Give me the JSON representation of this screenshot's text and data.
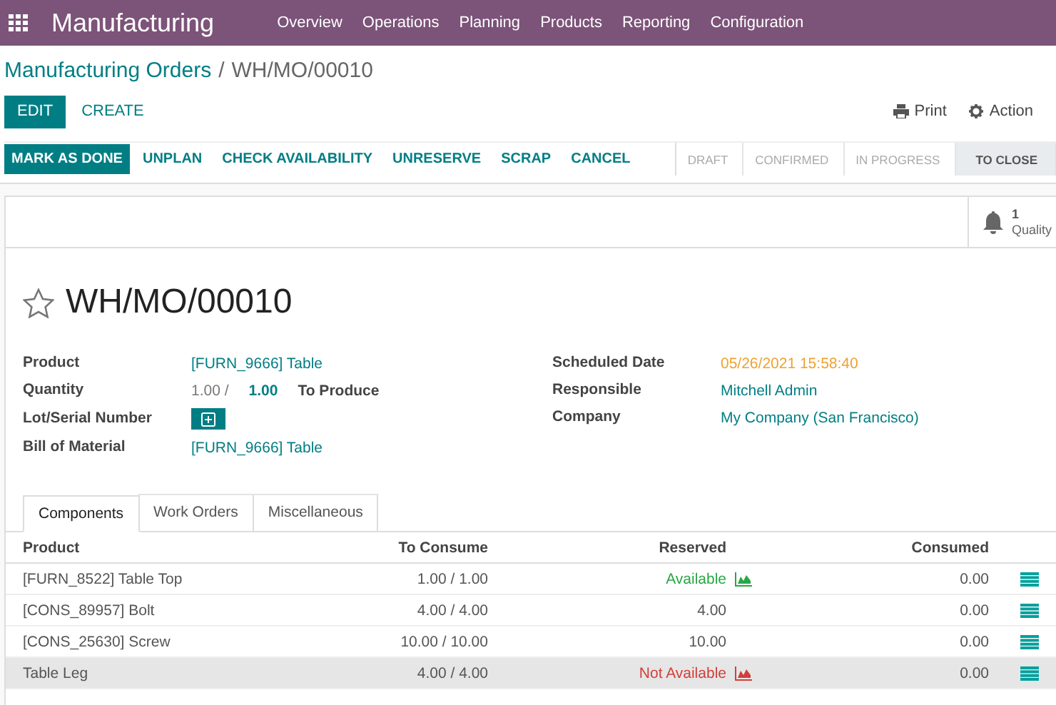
{
  "navbar": {
    "app_name": "Manufacturing",
    "menu": [
      "Overview",
      "Operations",
      "Planning",
      "Products",
      "Reporting",
      "Configuration"
    ]
  },
  "breadcrumb": {
    "parent": "Manufacturing Orders",
    "separator": "/",
    "current": "WH/MO/00010"
  },
  "actions": {
    "edit": "EDIT",
    "create": "CREATE",
    "print": "Print",
    "action": "Action"
  },
  "header_buttons": [
    {
      "label": "MARK AS DONE",
      "primary": true
    },
    {
      "label": "UNPLAN",
      "primary": false
    },
    {
      "label": "CHECK AVAILABILITY",
      "primary": false
    },
    {
      "label": "UNRESERVE",
      "primary": false
    },
    {
      "label": "SCRAP",
      "primary": false
    },
    {
      "label": "CANCEL",
      "primary": false
    }
  ],
  "stages": [
    {
      "label": "DRAFT",
      "selected": false
    },
    {
      "label": "CONFIRMED",
      "selected": false
    },
    {
      "label": "IN PROGRESS",
      "selected": false
    },
    {
      "label": "TO CLOSE",
      "selected": true
    }
  ],
  "smart_button": {
    "count": "1",
    "label": "Quality"
  },
  "record": {
    "starred": false,
    "title": "WH/MO/00010"
  },
  "fields_left": [
    {
      "label": "Product",
      "kind": "link",
      "value": "[FURN_9666] Table"
    },
    {
      "label": "Quantity",
      "kind": "quantity",
      "value": "1.00 /",
      "target": "1.00",
      "suffix": "To Produce"
    },
    {
      "label": "Lot/Serial Number",
      "kind": "add"
    },
    {
      "label": "Bill of Material",
      "kind": "link",
      "value": "[FURN_9666] Table"
    }
  ],
  "fields_right": [
    {
      "label": "Scheduled Date",
      "kind": "date",
      "value": "05/26/2021 15:58:40"
    },
    {
      "label": "Responsible",
      "kind": "link",
      "value": "Mitchell Admin"
    },
    {
      "label": "Company",
      "kind": "link",
      "value": "My Company (San Francisco)"
    }
  ],
  "tabs": [
    {
      "label": "Components",
      "selected": true
    },
    {
      "label": "Work Orders",
      "selected": false
    },
    {
      "label": "Miscellaneous",
      "selected": false
    }
  ],
  "table": {
    "columns": [
      "Product",
      "To Consume",
      "Reserved",
      "Consumed"
    ],
    "rows": [
      {
        "product": "[FURN_8522] Table Top",
        "to_consume": "1.00 / 1.00",
        "reserved": {
          "kind": "available",
          "text": "Available"
        },
        "consumed": "0.00",
        "highlighted": false
      },
      {
        "product": "[CONS_89957] Bolt",
        "to_consume": "4.00 / 4.00",
        "reserved": {
          "kind": "number",
          "text": "4.00"
        },
        "consumed": "0.00",
        "highlighted": false
      },
      {
        "product": "[CONS_25630] Screw",
        "to_consume": "10.00 / 10.00",
        "reserved": {
          "kind": "number",
          "text": "10.00"
        },
        "consumed": "0.00",
        "highlighted": false
      },
      {
        "product": "Table Leg",
        "to_consume": "4.00 / 4.00",
        "reserved": {
          "kind": "not_available",
          "text": "Not Available"
        },
        "consumed": "0.00",
        "highlighted": true
      }
    ]
  }
}
